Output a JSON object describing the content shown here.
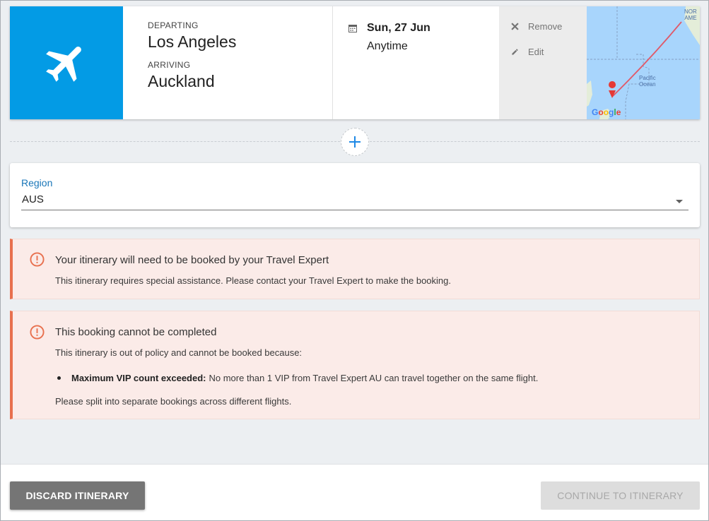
{
  "flight": {
    "icon": "airplane-icon",
    "departing_label": "DEPARTING",
    "departing_city": "Los Angeles",
    "arriving_label": "ARRIVING",
    "arriving_city": "Auckland",
    "date": "Sun, 27 Jun",
    "time": "Anytime",
    "remove_label": "Remove",
    "edit_label": "Edit",
    "map": {
      "label_top": "NOR\nAME",
      "label_ocean": "Pacific\nOcean",
      "google": "Google"
    }
  },
  "region": {
    "label": "Region",
    "value": "AUS"
  },
  "alerts": [
    {
      "title": "Your itinerary will need to be booked by your Travel Expert",
      "body": "This itinerary requires special assistance. Please contact your Travel Expert to make the booking."
    },
    {
      "title": "This booking cannot be completed",
      "body": "This itinerary is out of policy and cannot be booked because:",
      "bullet_bold": "Maximum VIP count exceeded:",
      "bullet_text": "No more than 1 VIP from Travel Expert AU can travel together on the same flight.",
      "footer": "Please split into separate bookings across different flights."
    }
  ],
  "footer": {
    "discard_label": "DISCARD ITINERARY",
    "continue_label": "CONTINUE TO ITINERARY"
  },
  "colors": {
    "plane_bg": "#039be5",
    "alert_accent": "#e8704e",
    "region_label": "#1976b8"
  }
}
